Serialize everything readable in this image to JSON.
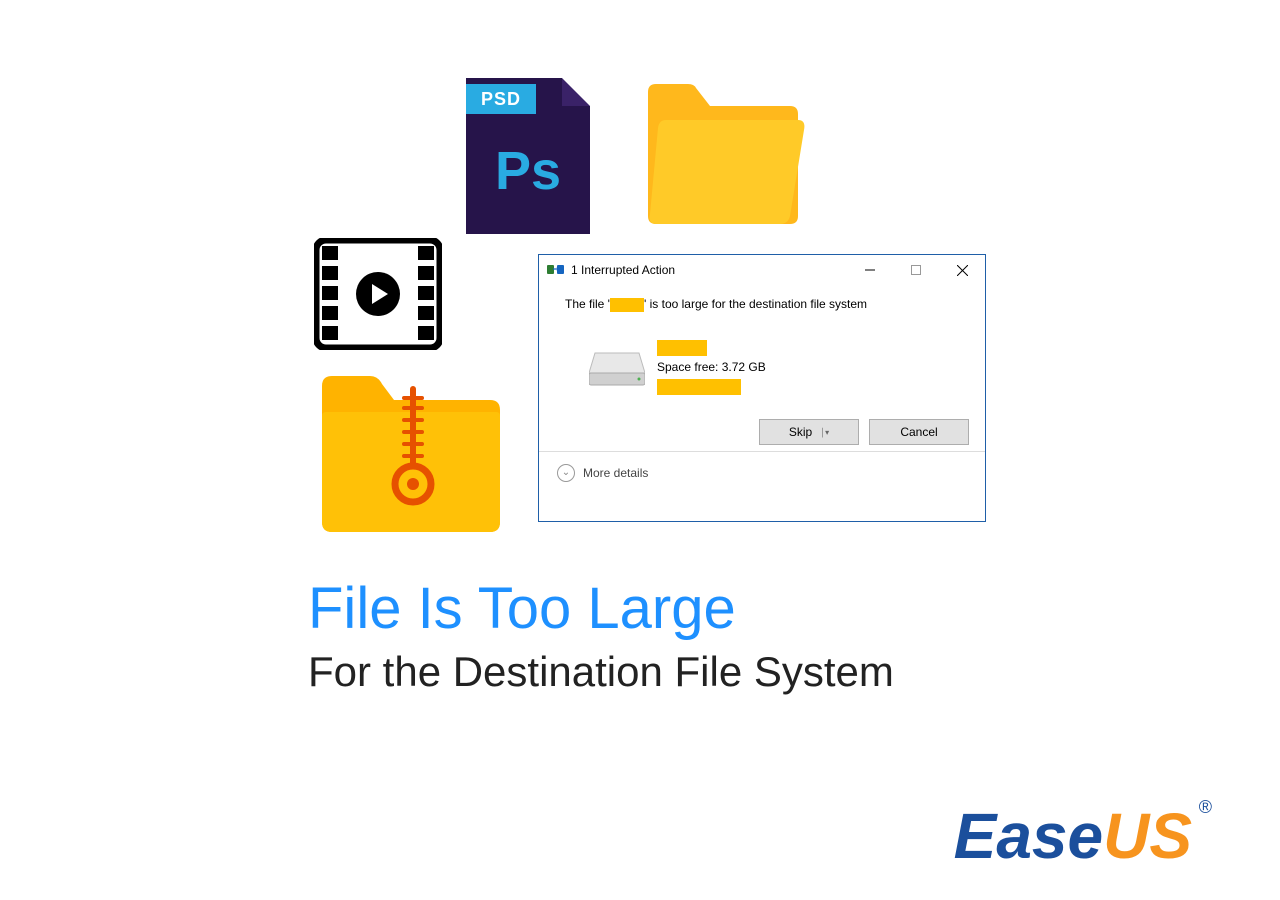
{
  "psd": {
    "label": "PSD",
    "ps": "Ps"
  },
  "dialog": {
    "title": "1 Interrupted Action",
    "message_pre": "The file '",
    "message_post": "' is too large for the destination file system",
    "space_free": "Space free: 3.72 GB",
    "skip": "Skip",
    "cancel": "Cancel",
    "more": "More details"
  },
  "headlines": {
    "line1": "File Is Too Large",
    "line2": "For the Destination File System"
  },
  "logo": {
    "ease": "Ease",
    "us": "US",
    "reg": "®"
  }
}
